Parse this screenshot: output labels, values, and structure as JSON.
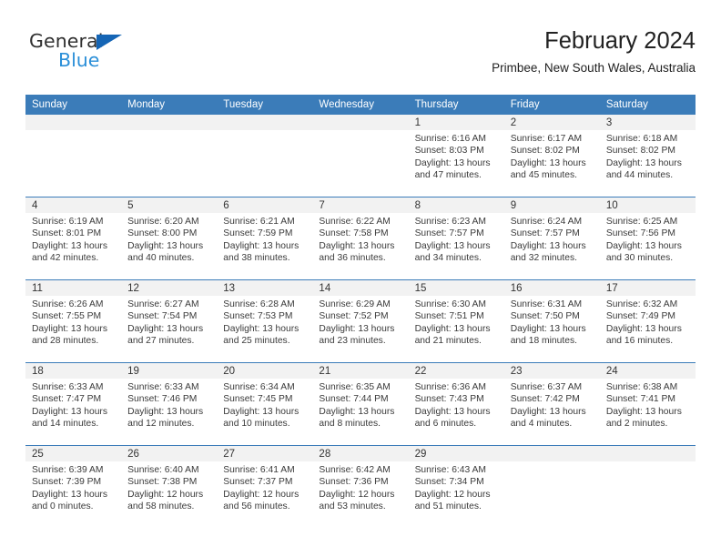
{
  "brand": {
    "name_top": "General",
    "name_bottom": "Blue",
    "triangle_icon": "brand-triangle-icon",
    "color_dark": "#2f2f2f",
    "color_blue": "#2b8fd8",
    "color_triangle": "#1565b5"
  },
  "header": {
    "title": "February 2024",
    "subtitle": "Primbee, New South Wales, Australia"
  },
  "theme": {
    "header_blue": "#3b7cb9",
    "daynum_band": "#f2f2f2",
    "text": "#3a3a3a"
  },
  "calendar": {
    "weekday_headers": [
      "Sunday",
      "Monday",
      "Tuesday",
      "Wednesday",
      "Thursday",
      "Friday",
      "Saturday"
    ],
    "weeks": [
      [
        {
          "day": "",
          "sunrise": "",
          "sunset": "",
          "daylight_line1": "",
          "daylight_line2": ""
        },
        {
          "day": "",
          "sunrise": "",
          "sunset": "",
          "daylight_line1": "",
          "daylight_line2": ""
        },
        {
          "day": "",
          "sunrise": "",
          "sunset": "",
          "daylight_line1": "",
          "daylight_line2": ""
        },
        {
          "day": "",
          "sunrise": "",
          "sunset": "",
          "daylight_line1": "",
          "daylight_line2": ""
        },
        {
          "day": "1",
          "sunrise": "Sunrise: 6:16 AM",
          "sunset": "Sunset: 8:03 PM",
          "daylight_line1": "Daylight: 13 hours",
          "daylight_line2": "and 47 minutes."
        },
        {
          "day": "2",
          "sunrise": "Sunrise: 6:17 AM",
          "sunset": "Sunset: 8:02 PM",
          "daylight_line1": "Daylight: 13 hours",
          "daylight_line2": "and 45 minutes."
        },
        {
          "day": "3",
          "sunrise": "Sunrise: 6:18 AM",
          "sunset": "Sunset: 8:02 PM",
          "daylight_line1": "Daylight: 13 hours",
          "daylight_line2": "and 44 minutes."
        }
      ],
      [
        {
          "day": "4",
          "sunrise": "Sunrise: 6:19 AM",
          "sunset": "Sunset: 8:01 PM",
          "daylight_line1": "Daylight: 13 hours",
          "daylight_line2": "and 42 minutes."
        },
        {
          "day": "5",
          "sunrise": "Sunrise: 6:20 AM",
          "sunset": "Sunset: 8:00 PM",
          "daylight_line1": "Daylight: 13 hours",
          "daylight_line2": "and 40 minutes."
        },
        {
          "day": "6",
          "sunrise": "Sunrise: 6:21 AM",
          "sunset": "Sunset: 7:59 PM",
          "daylight_line1": "Daylight: 13 hours",
          "daylight_line2": "and 38 minutes."
        },
        {
          "day": "7",
          "sunrise": "Sunrise: 6:22 AM",
          "sunset": "Sunset: 7:58 PM",
          "daylight_line1": "Daylight: 13 hours",
          "daylight_line2": "and 36 minutes."
        },
        {
          "day": "8",
          "sunrise": "Sunrise: 6:23 AM",
          "sunset": "Sunset: 7:57 PM",
          "daylight_line1": "Daylight: 13 hours",
          "daylight_line2": "and 34 minutes."
        },
        {
          "day": "9",
          "sunrise": "Sunrise: 6:24 AM",
          "sunset": "Sunset: 7:57 PM",
          "daylight_line1": "Daylight: 13 hours",
          "daylight_line2": "and 32 minutes."
        },
        {
          "day": "10",
          "sunrise": "Sunrise: 6:25 AM",
          "sunset": "Sunset: 7:56 PM",
          "daylight_line1": "Daylight: 13 hours",
          "daylight_line2": "and 30 minutes."
        }
      ],
      [
        {
          "day": "11",
          "sunrise": "Sunrise: 6:26 AM",
          "sunset": "Sunset: 7:55 PM",
          "daylight_line1": "Daylight: 13 hours",
          "daylight_line2": "and 28 minutes."
        },
        {
          "day": "12",
          "sunrise": "Sunrise: 6:27 AM",
          "sunset": "Sunset: 7:54 PM",
          "daylight_line1": "Daylight: 13 hours",
          "daylight_line2": "and 27 minutes."
        },
        {
          "day": "13",
          "sunrise": "Sunrise: 6:28 AM",
          "sunset": "Sunset: 7:53 PM",
          "daylight_line1": "Daylight: 13 hours",
          "daylight_line2": "and 25 minutes."
        },
        {
          "day": "14",
          "sunrise": "Sunrise: 6:29 AM",
          "sunset": "Sunset: 7:52 PM",
          "daylight_line1": "Daylight: 13 hours",
          "daylight_line2": "and 23 minutes."
        },
        {
          "day": "15",
          "sunrise": "Sunrise: 6:30 AM",
          "sunset": "Sunset: 7:51 PM",
          "daylight_line1": "Daylight: 13 hours",
          "daylight_line2": "and 21 minutes."
        },
        {
          "day": "16",
          "sunrise": "Sunrise: 6:31 AM",
          "sunset": "Sunset: 7:50 PM",
          "daylight_line1": "Daylight: 13 hours",
          "daylight_line2": "and 18 minutes."
        },
        {
          "day": "17",
          "sunrise": "Sunrise: 6:32 AM",
          "sunset": "Sunset: 7:49 PM",
          "daylight_line1": "Daylight: 13 hours",
          "daylight_line2": "and 16 minutes."
        }
      ],
      [
        {
          "day": "18",
          "sunrise": "Sunrise: 6:33 AM",
          "sunset": "Sunset: 7:47 PM",
          "daylight_line1": "Daylight: 13 hours",
          "daylight_line2": "and 14 minutes."
        },
        {
          "day": "19",
          "sunrise": "Sunrise: 6:33 AM",
          "sunset": "Sunset: 7:46 PM",
          "daylight_line1": "Daylight: 13 hours",
          "daylight_line2": "and 12 minutes."
        },
        {
          "day": "20",
          "sunrise": "Sunrise: 6:34 AM",
          "sunset": "Sunset: 7:45 PM",
          "daylight_line1": "Daylight: 13 hours",
          "daylight_line2": "and 10 minutes."
        },
        {
          "day": "21",
          "sunrise": "Sunrise: 6:35 AM",
          "sunset": "Sunset: 7:44 PM",
          "daylight_line1": "Daylight: 13 hours",
          "daylight_line2": "and 8 minutes."
        },
        {
          "day": "22",
          "sunrise": "Sunrise: 6:36 AM",
          "sunset": "Sunset: 7:43 PM",
          "daylight_line1": "Daylight: 13 hours",
          "daylight_line2": "and 6 minutes."
        },
        {
          "day": "23",
          "sunrise": "Sunrise: 6:37 AM",
          "sunset": "Sunset: 7:42 PM",
          "daylight_line1": "Daylight: 13 hours",
          "daylight_line2": "and 4 minutes."
        },
        {
          "day": "24",
          "sunrise": "Sunrise: 6:38 AM",
          "sunset": "Sunset: 7:41 PM",
          "daylight_line1": "Daylight: 13 hours",
          "daylight_line2": "and 2 minutes."
        }
      ],
      [
        {
          "day": "25",
          "sunrise": "Sunrise: 6:39 AM",
          "sunset": "Sunset: 7:39 PM",
          "daylight_line1": "Daylight: 13 hours",
          "daylight_line2": "and 0 minutes."
        },
        {
          "day": "26",
          "sunrise": "Sunrise: 6:40 AM",
          "sunset": "Sunset: 7:38 PM",
          "daylight_line1": "Daylight: 12 hours",
          "daylight_line2": "and 58 minutes."
        },
        {
          "day": "27",
          "sunrise": "Sunrise: 6:41 AM",
          "sunset": "Sunset: 7:37 PM",
          "daylight_line1": "Daylight: 12 hours",
          "daylight_line2": "and 56 minutes."
        },
        {
          "day": "28",
          "sunrise": "Sunrise: 6:42 AM",
          "sunset": "Sunset: 7:36 PM",
          "daylight_line1": "Daylight: 12 hours",
          "daylight_line2": "and 53 minutes."
        },
        {
          "day": "29",
          "sunrise": "Sunrise: 6:43 AM",
          "sunset": "Sunset: 7:34 PM",
          "daylight_line1": "Daylight: 12 hours",
          "daylight_line2": "and 51 minutes."
        },
        {
          "day": "",
          "sunrise": "",
          "sunset": "",
          "daylight_line1": "",
          "daylight_line2": ""
        },
        {
          "day": "",
          "sunrise": "",
          "sunset": "",
          "daylight_line1": "",
          "daylight_line2": ""
        }
      ]
    ]
  }
}
